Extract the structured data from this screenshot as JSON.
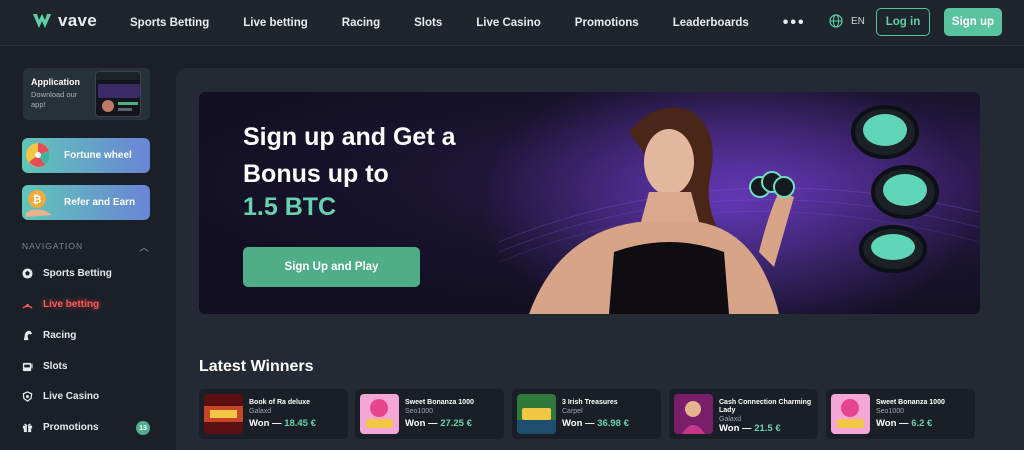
{
  "brand": {
    "name": "vave"
  },
  "header": {
    "nav": [
      "Sports Betting",
      "Live betting",
      "Racing",
      "Slots",
      "Live Casino",
      "Promotions",
      "Leaderboards"
    ],
    "more": "•••",
    "language": "EN",
    "login_label": "Log in",
    "signup_label": "Sign up"
  },
  "sidebar": {
    "app_card": {
      "title": "Application",
      "subtitle": "Download our app!"
    },
    "promos": [
      {
        "label": "Fortune wheel",
        "icon": "fortune-wheel-icon"
      },
      {
        "label": "Refer and Earn",
        "icon": "bitcoin-hand-icon"
      }
    ],
    "nav_heading": "NAVIGATION",
    "items": [
      {
        "label": "Sports Betting",
        "icon": "soccer-ball-icon"
      },
      {
        "label": "Live betting",
        "icon": "live-signal-icon",
        "active": true
      },
      {
        "label": "Racing",
        "icon": "horse-icon"
      },
      {
        "label": "Slots",
        "icon": "slot-machine-icon"
      },
      {
        "label": "Live Casino",
        "icon": "casino-chip-icon"
      },
      {
        "label": "Promotions",
        "icon": "gift-icon"
      }
    ],
    "promotions_badge": "13"
  },
  "hero": {
    "title": "Sign up and Get a Bonus up to",
    "amount": "1.5 BTC",
    "cta": "Sign Up and Play"
  },
  "latest_winners": {
    "title": "Latest Winners",
    "items": [
      {
        "game": "Book of Ra deluxe",
        "user": "Galaxd",
        "won_prefix": "Won —",
        "amount": "18.45 €"
      },
      {
        "game": "Sweet Bonanza 1000",
        "user": "Seo1000",
        "won_prefix": "Won —",
        "amount": "27.25 €"
      },
      {
        "game": "3 Irish Treasures",
        "user": "Carpel",
        "won_prefix": "Won —",
        "amount": "36.98 €"
      },
      {
        "game": "Cash Connection Charming Lady",
        "user": "Galaxd",
        "won_prefix": "Won —",
        "amount": "21.5 €"
      },
      {
        "game": "Sweet Bonanza 1000",
        "user": "Seo1000",
        "won_prefix": "Won —",
        "amount": "6.2 €"
      }
    ]
  },
  "colors": {
    "accent": "#59c39f",
    "active": "#ff5b5b",
    "background": "#1b2028"
  }
}
